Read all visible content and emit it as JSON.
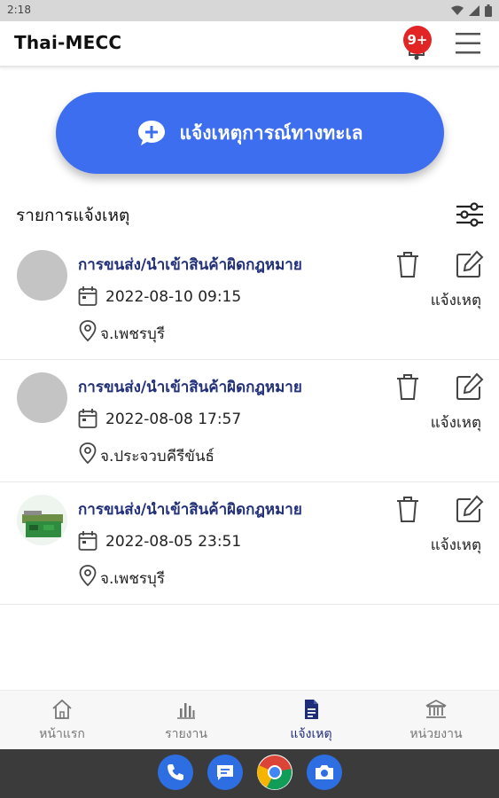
{
  "status_bar": {
    "time": "2:18"
  },
  "app_bar": {
    "title": "Thai-MECC",
    "notification_badge": "9+"
  },
  "report_button": {
    "label": "แจ้งเหตุการณ์ทางทะเล"
  },
  "list_section": {
    "title": "รายการแจ้งเหตุ"
  },
  "reports": [
    {
      "title": "การขนส่ง/นำเข้าสินค้าผิดกฎหมาย",
      "datetime": "2022-08-10 09:15",
      "province": "จ.เพชรบุรี",
      "status": "แจ้งเหตุ"
    },
    {
      "title": "การขนส่ง/นำเข้าสินค้าผิดกฎหมาย",
      "datetime": "2022-08-08 17:57",
      "province": "จ.ประจวบคีรีขันธ์",
      "status": "แจ้งเหตุ"
    },
    {
      "title": "การขนส่ง/นำเข้าสินค้าผิดกฎหมาย",
      "datetime": "2022-08-05 23:51",
      "province": "จ.เพชรบุรี",
      "status": "แจ้งเหตุ"
    }
  ],
  "bottom_nav": [
    {
      "label": "หน้าแรก",
      "icon": "home-icon"
    },
    {
      "label": "รายงาน",
      "icon": "bar-chart-icon"
    },
    {
      "label": "แจ้งเหตุ",
      "icon": "document-icon",
      "active": true
    },
    {
      "label": "หน่วยงาน",
      "icon": "institution-icon"
    }
  ],
  "colors": {
    "primary": "#3e6ef0",
    "title_blue": "#22307a",
    "badge_red": "#e22424"
  }
}
